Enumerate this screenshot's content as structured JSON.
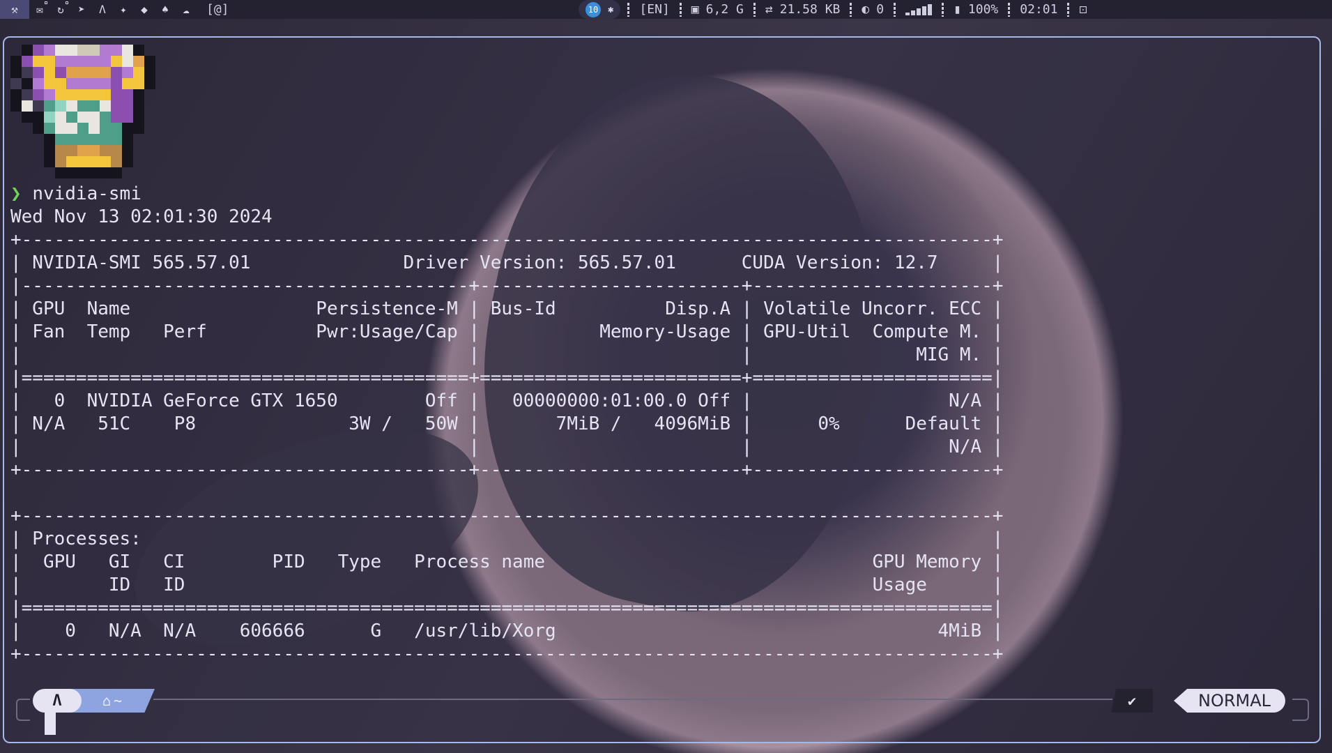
{
  "topbar": {
    "workspaces": [
      {
        "icon": "terminal-icon",
        "glyph": "⚒",
        "active": true
      },
      {
        "icon": "mail-icon",
        "glyph": "✉"
      },
      {
        "icon": "refresh-icon",
        "glyph": "↻"
      },
      {
        "icon": "telegram-icon",
        "glyph": "➤"
      },
      {
        "icon": "arch-icon",
        "glyph": "Λ"
      },
      {
        "icon": "editor-icon",
        "glyph": "✦"
      },
      {
        "icon": "git-icon",
        "glyph": "◆"
      },
      {
        "icon": "linux-icon",
        "glyph": "♠"
      },
      {
        "icon": "docker-icon",
        "glyph": "☁"
      }
    ],
    "window_title": "[@]",
    "tray": {
      "telegram_badge": "10",
      "bluetooth": "✱"
    },
    "keyboard_layout": "[EN]",
    "memory": "6,2 G",
    "network": "21.58 KB",
    "notifications": "0",
    "battery": "100%",
    "clock": "02:01",
    "last_icon": "⚀"
  },
  "terminal": {
    "command": "nvidia-smi",
    "output": "Wed Nov 13 02:01:30 2024\n+-----------------------------------------------------------------------------------------+\n| NVIDIA-SMI 565.57.01              Driver Version: 565.57.01      CUDA Version: 12.7     |\n|-----------------------------------------+------------------------+----------------------+\n| GPU  Name                 Persistence-M | Bus-Id          Disp.A | Volatile Uncorr. ECC |\n| Fan  Temp   Perf          Pwr:Usage/Cap |           Memory-Usage | GPU-Util  Compute M. |\n|                                         |                        |               MIG M. |\n|=========================================+========================+======================|\n|   0  NVIDIA GeForce GTX 1650        Off |   00000000:01:00.0 Off |                  N/A |\n| N/A   51C    P8              3W /   50W |       7MiB /   4096MiB |      0%      Default |\n|                                         |                        |                  N/A |\n+-----------------------------------------+------------------------+----------------------+\n\n+-----------------------------------------------------------------------------------------+\n| Processes:                                                                              |\n|  GPU   GI   CI        PID   Type   Process name                              GPU Memory |\n|        ID   ID                                                               Usage      |\n|=========================================================================================|\n|    0   N/A  N/A    606666      G   /usr/lib/Xorg                                   4MiB |\n+-----------------------------------------------------------------------------------------+"
  },
  "prompt": {
    "os_icon": "Λ",
    "home_icon": "⌂",
    "directory": "~",
    "status": "✔",
    "mode": "NORMAL"
  },
  "colors": {
    "accent": "#a8b8e6",
    "prompt_green": "#6fd25a",
    "dir_segment": "#8ea4e0"
  }
}
